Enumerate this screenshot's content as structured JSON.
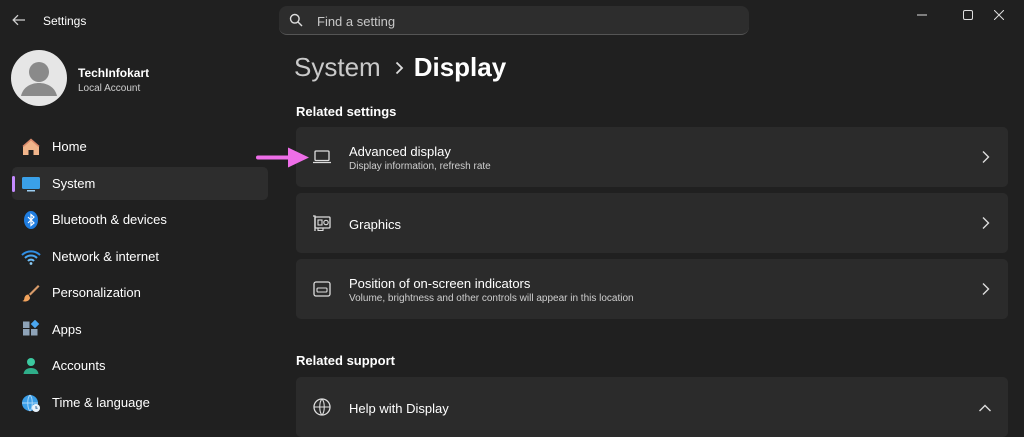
{
  "window": {
    "app_title": "Settings"
  },
  "search": {
    "placeholder": "Find a setting"
  },
  "profile": {
    "name": "TechInfokart",
    "account_type": "Local Account"
  },
  "sidebar": {
    "items": [
      {
        "label": "Home",
        "icon": "home-icon"
      },
      {
        "label": "System",
        "icon": "system-icon",
        "active": true
      },
      {
        "label": "Bluetooth & devices",
        "icon": "bluetooth-icon"
      },
      {
        "label": "Network & internet",
        "icon": "wifi-icon"
      },
      {
        "label": "Personalization",
        "icon": "brush-icon"
      },
      {
        "label": "Apps",
        "icon": "apps-icon"
      },
      {
        "label": "Accounts",
        "icon": "person-icon"
      },
      {
        "label": "Time & language",
        "icon": "globe-clock-icon"
      }
    ]
  },
  "breadcrumb": {
    "parent": "System",
    "current": "Display"
  },
  "related_settings": {
    "title": "Related settings",
    "items": [
      {
        "title": "Advanced display",
        "subtitle": "Display information, refresh rate",
        "icon": "monitor-icon"
      },
      {
        "title": "Graphics",
        "icon": "graphics-card-icon"
      },
      {
        "title": "Position of on-screen indicators",
        "subtitle": "Volume, brightness and other controls will appear in this location",
        "icon": "onscreen-indicator-icon"
      }
    ]
  },
  "related_support": {
    "title": "Related support",
    "items": [
      {
        "title": "Help with Display",
        "icon": "globe-icon",
        "expanded": true
      }
    ]
  },
  "colors": {
    "background": "#202020",
    "card": "#2b2b2b",
    "accent": "#c58bff",
    "annotation_arrow": "#ee6ee8"
  }
}
